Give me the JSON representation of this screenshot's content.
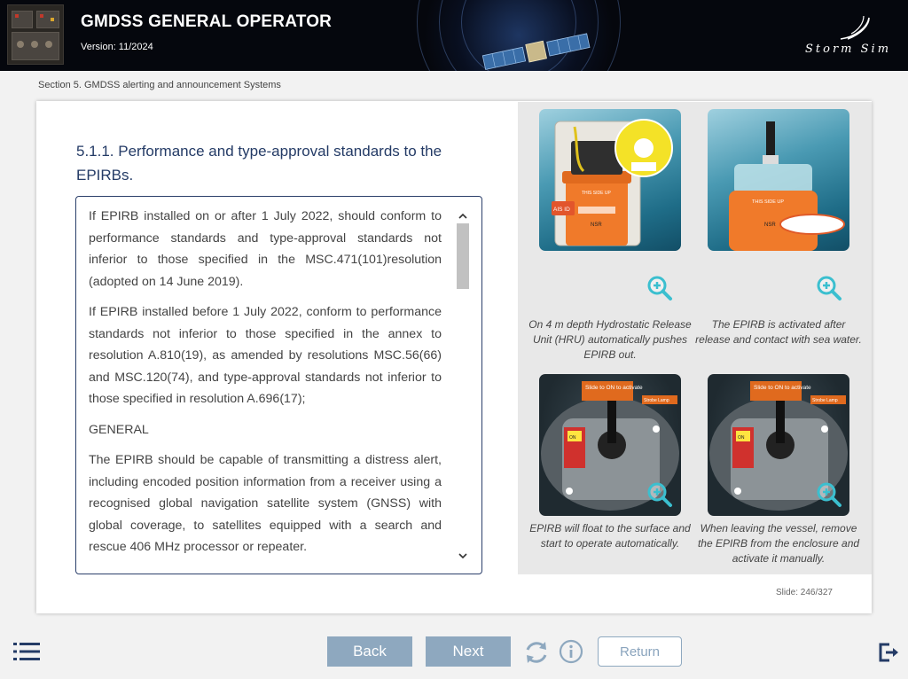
{
  "header": {
    "title": "GMDSS GENERAL OPERATOR",
    "version": "Version: 11/2024",
    "brand": "Storm Sim"
  },
  "breadcrumb": "Section 5. GMDSS alerting and announcement Systems",
  "lesson": {
    "heading": "5.1.1. Performance and type-approval standards to the EPIRBs.",
    "paragraphs": [
      "If EPIRB installed on or after 1 July 2022, should conform to performance standards and type-approval standards not inferior to those specified in the MSC.471(101)resolution (adopted on 14 June 2019).",
      "If EPIRB installed before 1 July 2022, conform to performance standards not inferior to those specified in the annex to resolution A.810(19), as amended by resolutions MSC.56(66) and MSC.120(74), and type-approval standards not inferior to those specified in resolution A.696(17);",
      "GENERAL",
      "The EPIRB should be capable of transmitting a distress alert, including encoded position information from a receiver using a recognised global navigation satellite system (GNSS) with global coverage, to satellites equipped with a search and rescue 406 MHz processor or repeater."
    ]
  },
  "gallery": {
    "captions": [
      "On 4 m depth Hydrostatic Release Unit (HRU) automatically pushes EPIRB out.",
      "The EPIRB is activated after release and contact with sea water.",
      "EPIRB will float to the surface and start to operate automatically.",
      "When leaving the vessel, remove the EPIRB from the enclosure and activate it manually."
    ],
    "image_labels": {
      "ais_id": "AIS ID",
      "this_side_up": "THIS SIDE UP",
      "nsr": "NSR",
      "slide_on": "Slide to ON to activate",
      "strobe_lamp": "Strobe Lamp",
      "on": "ON"
    }
  },
  "slide_counter": "Slide: 246/327",
  "footer": {
    "back": "Back",
    "next": "Next",
    "return": "Return"
  },
  "colors": {
    "header_bg": "#05070d",
    "heading": "#243b66",
    "nav_button": "#8ea8bf",
    "textbox_border": "#2b3f6a",
    "epirb_orange": "#f07a2a",
    "zoom_teal": "#3bbfcf"
  }
}
